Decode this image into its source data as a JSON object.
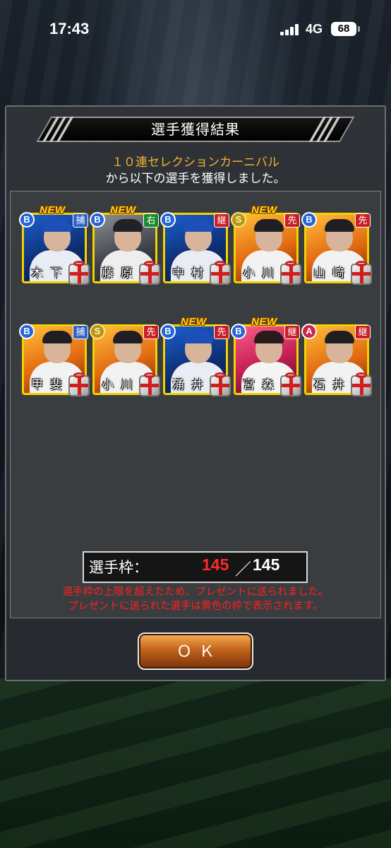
{
  "status_bar": {
    "time": "17:43",
    "network": "4G",
    "battery": "68"
  },
  "dialog": {
    "title": "選手獲得結果",
    "subtitle_event": "１０連セレクションカーニバル",
    "subtitle_text": "から以下の選手を獲得しました。",
    "ok_label": "ＯＫ"
  },
  "new_badge_text": "NEW",
  "players": [
    {
      "name": "木下",
      "rank": "B",
      "position": "捕",
      "position_color": "#2d62c8",
      "new": true,
      "theme": "blue"
    },
    {
      "name": "藤原",
      "rank": "B",
      "position": "右",
      "position_color": "#178a2e",
      "new": true,
      "theme": "gray"
    },
    {
      "name": "中村",
      "rank": "B",
      "position": "継",
      "position_color": "#c81e24",
      "new": false,
      "theme": "blue"
    },
    {
      "name": "小川",
      "rank": "S",
      "position": "先",
      "position_color": "#c81e24",
      "new": true,
      "theme": "orange"
    },
    {
      "name": "山﨑",
      "rank": "B",
      "position": "先",
      "position_color": "#c81e24",
      "new": false,
      "theme": "orange"
    },
    {
      "name": "甲斐",
      "rank": "B",
      "position": "捕",
      "position_color": "#2d62c8",
      "new": false,
      "theme": "orange"
    },
    {
      "name": "小川",
      "rank": "S",
      "position": "先",
      "position_color": "#c81e24",
      "new": false,
      "theme": "orange"
    },
    {
      "name": "涌井",
      "rank": "B",
      "position": "先",
      "position_color": "#c81e24",
      "new": true,
      "theme": "blue"
    },
    {
      "name": "宮森",
      "rank": "B",
      "position": "継",
      "position_color": "#c81e24",
      "new": true,
      "theme": "pink"
    },
    {
      "name": "石井",
      "rank": "A",
      "position": "継",
      "position_color": "#c81e24",
      "new": false,
      "theme": "orange"
    }
  ],
  "roster": {
    "label": "選手枠：",
    "current": "145",
    "separator": "／",
    "max": "145"
  },
  "warnings": {
    "line1": "選手枠の上限を超えたため、プレゼントに送られました。",
    "line2": "プレゼントに送られた選手は黄色の枠で表示されます。"
  }
}
